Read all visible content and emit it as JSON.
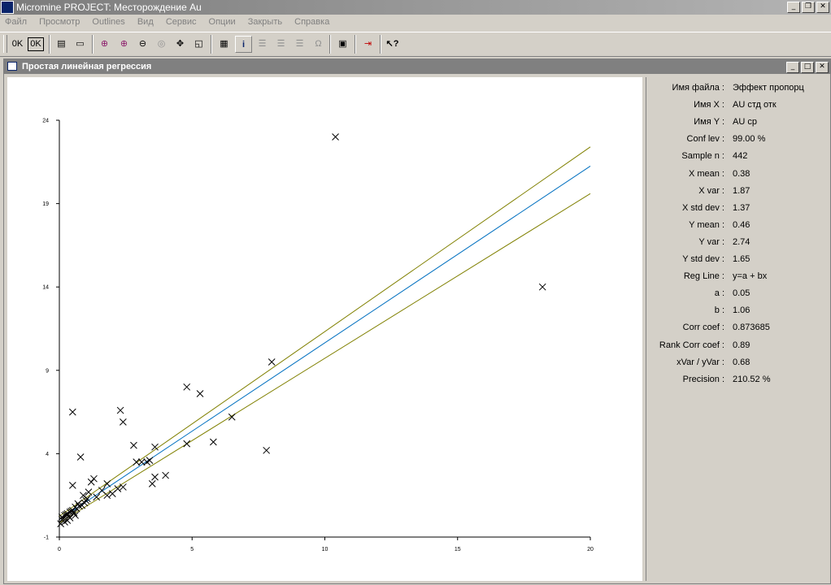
{
  "app": {
    "title": "Micromine    PROJECT: Месторождение Au"
  },
  "menu": [
    "Файл",
    "Просмотр",
    "Outlines",
    "Вид",
    "Сервис",
    "Опции",
    "Закрыть",
    "Справка"
  ],
  "toolbar": {
    "ok_label": "0K"
  },
  "window": {
    "title": "Простая линейная регрессия"
  },
  "stats": [
    {
      "label": "Имя файла :",
      "value": "Эффект пропорц"
    },
    {
      "label": "Имя X :",
      "value": "AU стд отк"
    },
    {
      "label": "Имя Y :",
      "value": "AU ср"
    },
    {
      "label": "Conf lev :",
      "value": "99.00  %"
    },
    {
      "label": "Sample n :",
      "value": "442"
    },
    {
      "label": "X mean :",
      "value": "0.38"
    },
    {
      "label": "X var :",
      "value": "1.87"
    },
    {
      "label": "X std dev :",
      "value": "1.37"
    },
    {
      "label": "Y mean :",
      "value": "0.46"
    },
    {
      "label": "Y var :",
      "value": "2.74"
    },
    {
      "label": "Y std dev :",
      "value": "1.65"
    },
    {
      "label": "Reg Line :",
      "value": "y=a + bx"
    },
    {
      "label": "a :",
      "value": "0.05"
    },
    {
      "label": "b :",
      "value": "1.06"
    },
    {
      "label": "Corr coef :",
      "value": "0.873685"
    },
    {
      "label": "Rank Corr coef :",
      "value": "0.89"
    },
    {
      "label": "xVar / yVar :",
      "value": "0.68"
    },
    {
      "label": "Precision :",
      "value": "210.52      %"
    }
  ],
  "chart_data": {
    "type": "scatter",
    "xlim": [
      0,
      20
    ],
    "ylim": [
      -1,
      24
    ],
    "x_ticks": [
      "0",
      "5",
      "10",
      "15",
      "20"
    ],
    "y_ticks": [
      "-1",
      "4",
      "9",
      "14",
      "19",
      "24"
    ],
    "points": [
      [
        10.4,
        23.0
      ],
      [
        18.2,
        14.0
      ],
      [
        8.0,
        9.5
      ],
      [
        7.8,
        4.2
      ],
      [
        4.8,
        8.0
      ],
      [
        5.3,
        7.6
      ],
      [
        6.5,
        6.2
      ],
      [
        5.8,
        4.7
      ],
      [
        4.8,
        4.6
      ],
      [
        2.3,
        6.6
      ],
      [
        2.4,
        5.9
      ],
      [
        0.5,
        6.5
      ],
      [
        2.8,
        4.5
      ],
      [
        3.6,
        4.4
      ],
      [
        0.8,
        3.8
      ],
      [
        2.9,
        3.5
      ],
      [
        3.1,
        3.5
      ],
      [
        3.4,
        3.6
      ],
      [
        3.3,
        3.5
      ],
      [
        3.6,
        2.6
      ],
      [
        4.0,
        2.7
      ],
      [
        3.5,
        2.2
      ],
      [
        2.4,
        2.0
      ],
      [
        2.2,
        1.9
      ],
      [
        1.3,
        2.5
      ],
      [
        1.2,
        2.3
      ],
      [
        1.8,
        2.2
      ],
      [
        2.0,
        1.6
      ],
      [
        1.6,
        1.8
      ],
      [
        1.8,
        1.5
      ],
      [
        1.4,
        1.4
      ],
      [
        0.5,
        2.1
      ],
      [
        1.0,
        1.2
      ],
      [
        0.9,
        1.5
      ],
      [
        1.1,
        1.7
      ],
      [
        0.7,
        1.0
      ],
      [
        0.6,
        0.8
      ],
      [
        0.5,
        0.6
      ],
      [
        0.4,
        0.5
      ],
      [
        0.3,
        0.4
      ],
      [
        0.2,
        0.3
      ],
      [
        0.1,
        0.2
      ],
      [
        0.15,
        0.1
      ],
      [
        0.25,
        0.35
      ],
      [
        0.35,
        0.25
      ],
      [
        0.45,
        0.55
      ],
      [
        0.55,
        0.45
      ],
      [
        0.65,
        0.7
      ],
      [
        0.75,
        0.85
      ],
      [
        0.85,
        0.9
      ],
      [
        0.95,
        1.05
      ],
      [
        1.05,
        1.3
      ],
      [
        0.3,
        0.0
      ],
      [
        0.2,
        -0.1
      ],
      [
        0.1,
        0.05
      ],
      [
        0.05,
        -0.2
      ],
      [
        0.4,
        0.15
      ],
      [
        0.6,
        0.3
      ]
    ],
    "regression": {
      "a": 0.05,
      "b": 1.06
    },
    "conf_band": {
      "upper": [
        [
          0,
          0.25
        ],
        [
          20,
          22.4
        ]
      ],
      "lower": [
        [
          0,
          -0.15
        ],
        [
          20,
          19.6
        ]
      ]
    },
    "colors": {
      "points": "#000000",
      "regression": "#0070c0",
      "band": "#808000"
    }
  }
}
